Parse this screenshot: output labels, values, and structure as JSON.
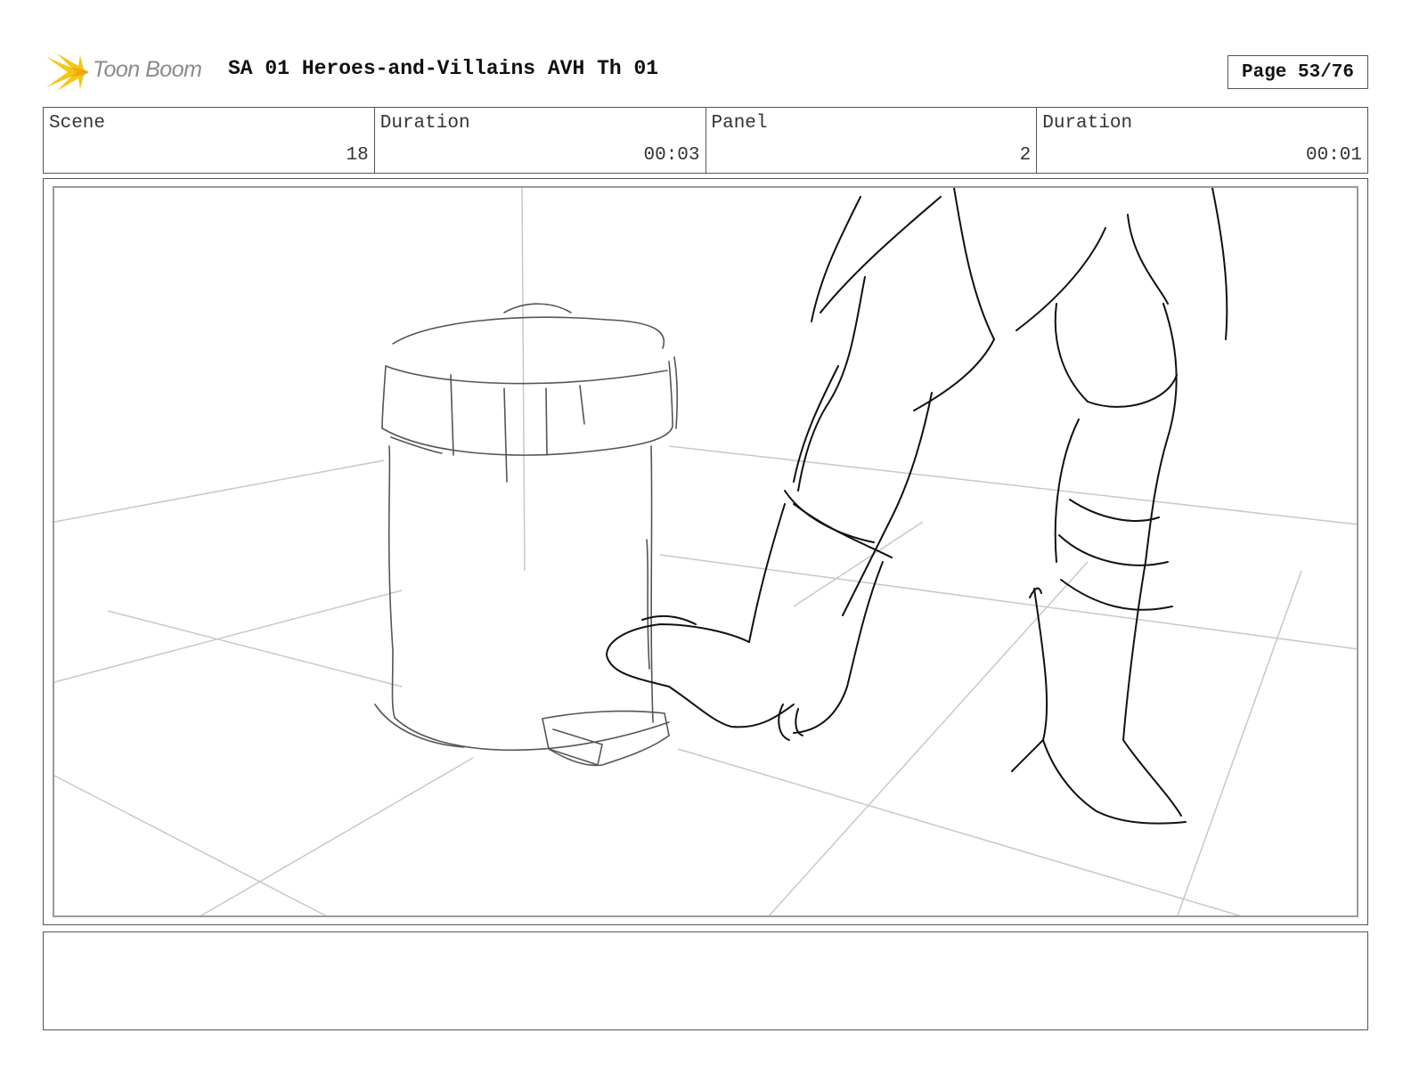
{
  "header": {
    "logo_text": "Toon Boom",
    "title": "SA 01 Heroes-and-Villains AVH Th 01",
    "page_label": "Page 53/76"
  },
  "info": {
    "scene_label": "Scene",
    "scene_value": "18",
    "scene_duration_label": "Duration",
    "scene_duration_value": "00:03",
    "panel_label": "Panel",
    "panel_value": "2",
    "panel_duration_label": "Duration",
    "panel_duration_value": "00:01"
  },
  "notes": {
    "text": ""
  },
  "colors": {
    "logo_accent": "#f5c518",
    "border": "#555555",
    "sketch_line": "#222222",
    "guide_line": "#c8c8c8"
  }
}
